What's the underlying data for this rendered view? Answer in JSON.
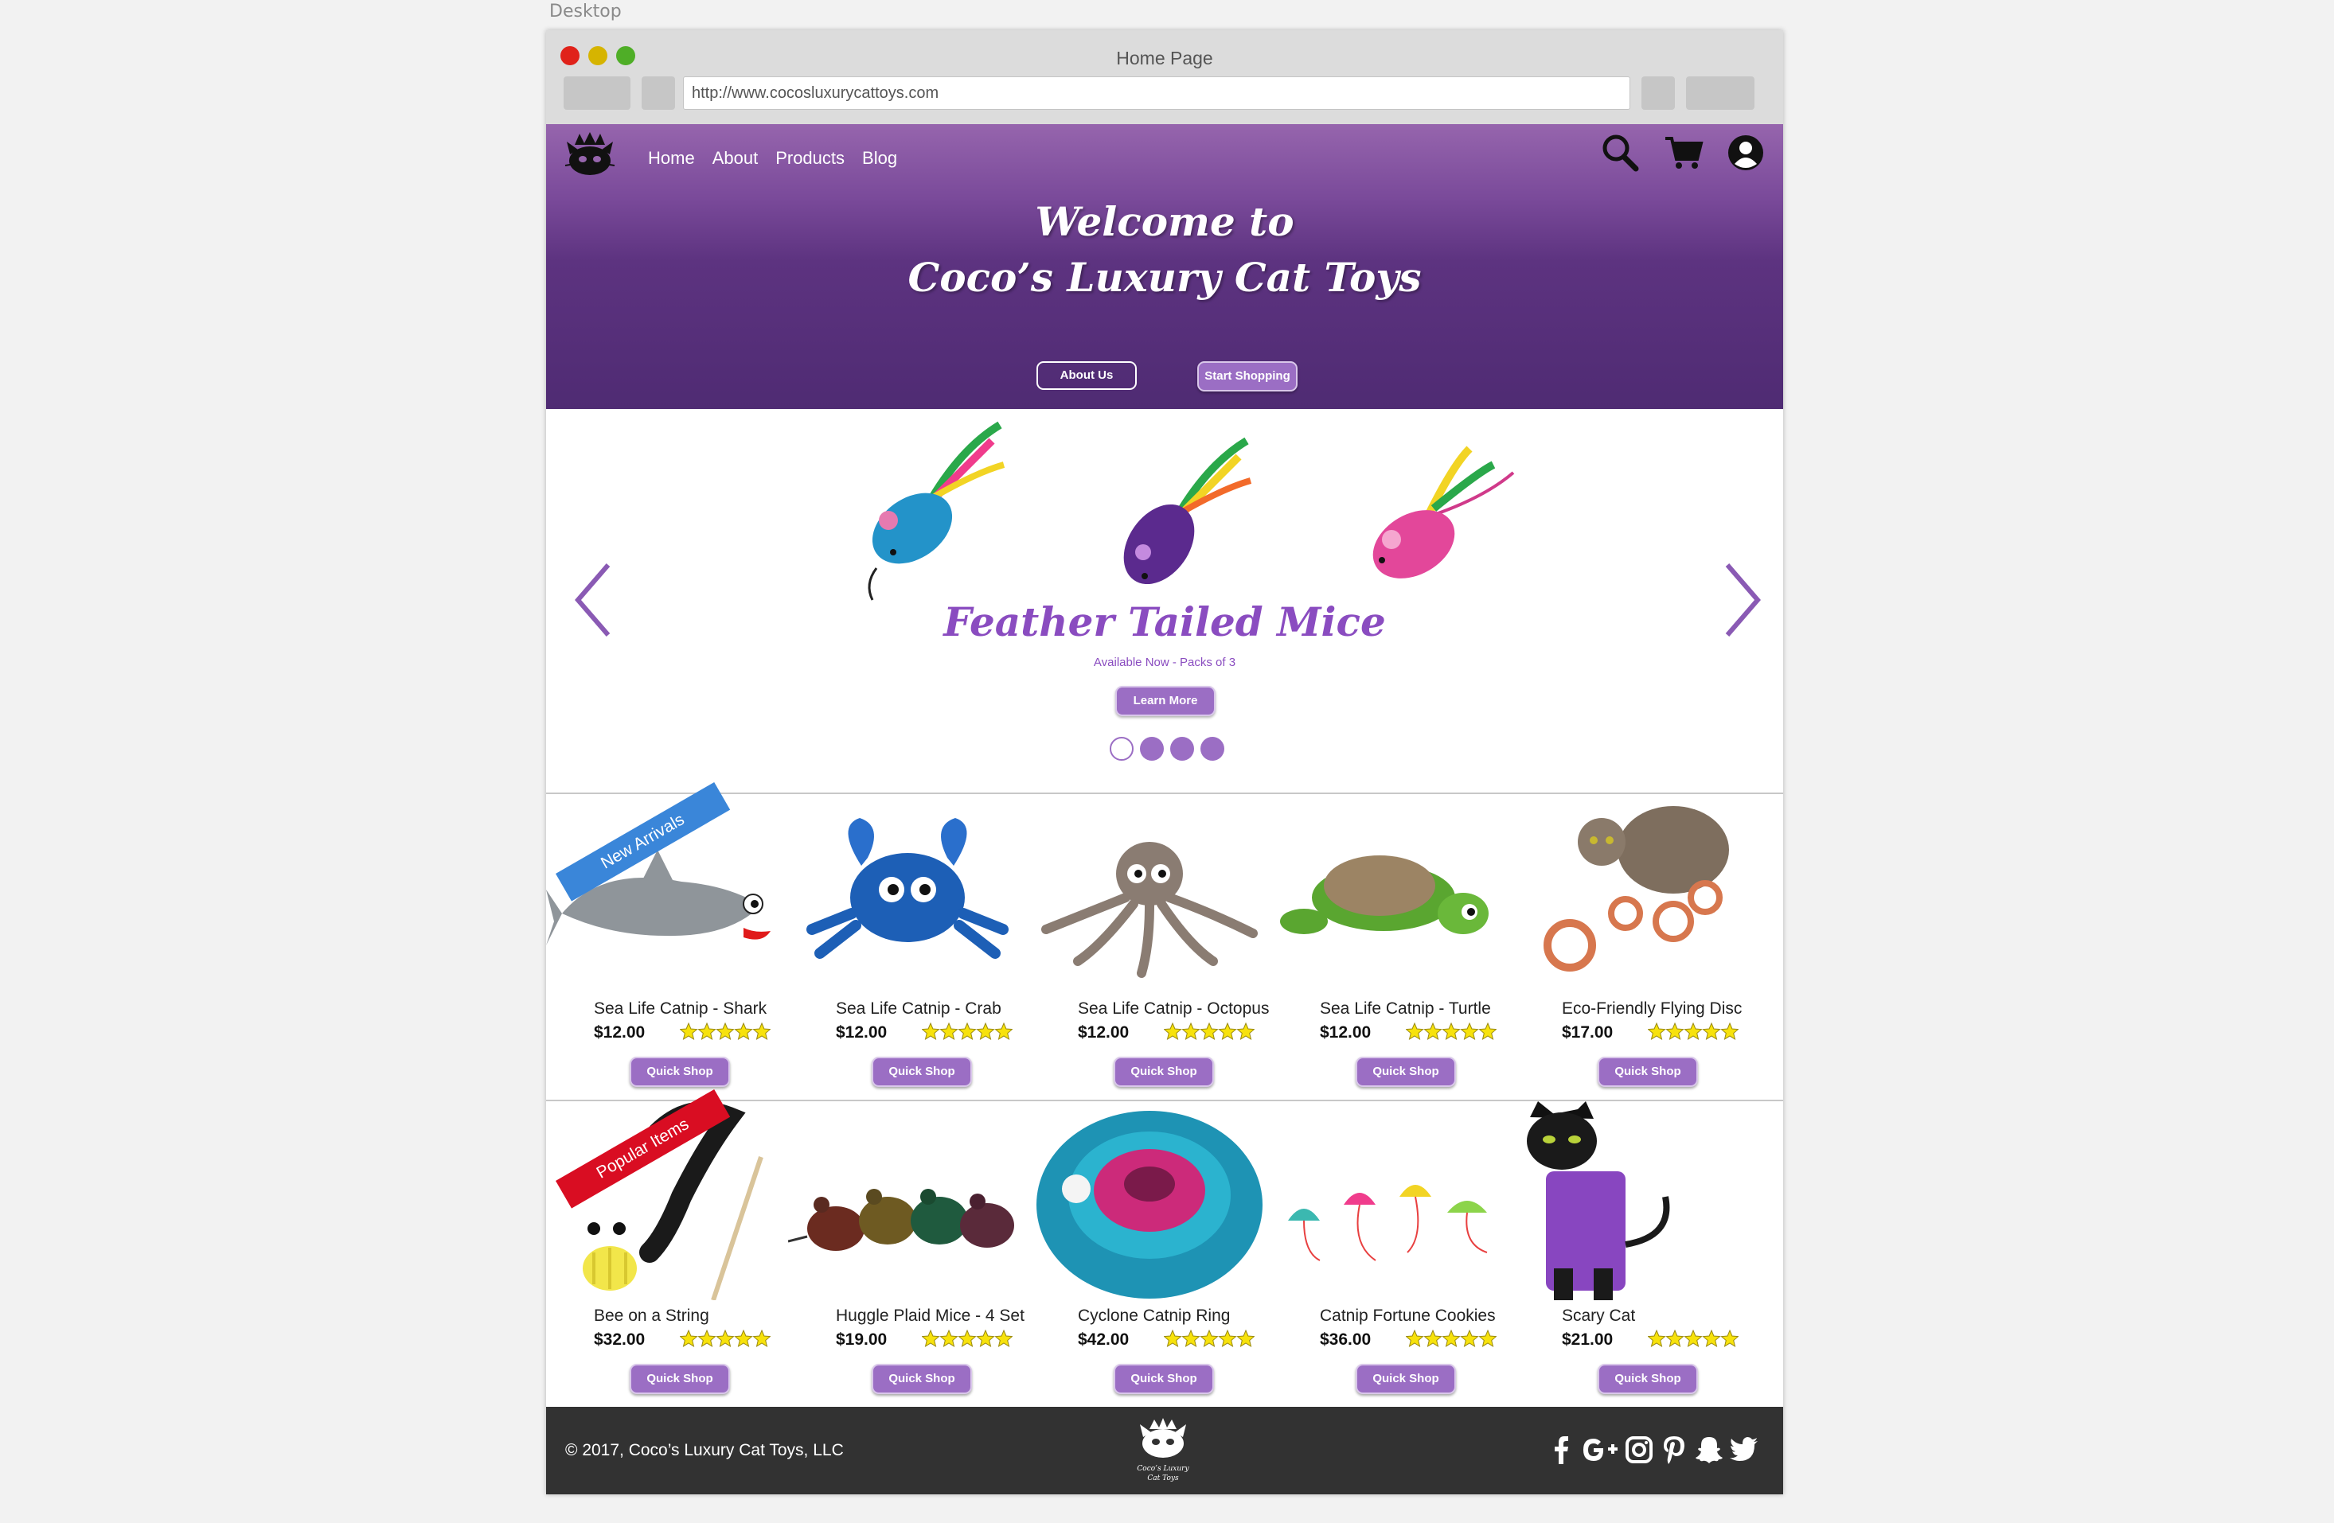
{
  "canvas_label": "Desktop",
  "window": {
    "title": "Home Page",
    "url": "http://www.cocosluxurycattoys.com"
  },
  "header": {
    "nav": [
      "Home",
      "About",
      "Products",
      "Blog"
    ],
    "icons": [
      "search-icon",
      "cart-icon",
      "account-icon"
    ]
  },
  "hero": {
    "title_line1": "Welcome to",
    "title_line2": "Coco’s Luxury Cat Toys",
    "about_button": "About Us",
    "shop_button": "Start Shopping"
  },
  "carousel": {
    "title": "Feather Tailed Mice",
    "subtitle": "Available Now - Packs of 3",
    "button": "Learn More",
    "slide_count": 4,
    "active_slide": 1
  },
  "rows": [
    {
      "ribbon": "New Arrivals",
      "products": [
        {
          "name": "Sea Life Catnip - Shark",
          "price": "$12.00",
          "rating": 5
        },
        {
          "name": "Sea Life Catnip - Crab",
          "price": "$12.00",
          "rating": 5
        },
        {
          "name": "Sea Life Catnip - Octopus",
          "price": "$12.00",
          "rating": 5
        },
        {
          "name": "Sea Life Catnip - Turtle",
          "price": "$12.00",
          "rating": 5
        },
        {
          "name": "Eco-Friendly Flying Disc",
          "price": "$17.00",
          "rating": 5
        }
      ]
    },
    {
      "ribbon": "Popular Items",
      "products": [
        {
          "name": "Bee on a String",
          "price": "$32.00",
          "rating": 5
        },
        {
          "name": "Huggle Plaid Mice - 4 Set",
          "price": "$19.00",
          "rating": 5
        },
        {
          "name": "Cyclone Catnip Ring",
          "price": "$42.00",
          "rating": 5
        },
        {
          "name": "Catnip Fortune Cookies",
          "price": "$36.00",
          "rating": 5
        },
        {
          "name": "Scary Cat",
          "price": "$21.00",
          "rating": 5
        }
      ]
    }
  ],
  "quick_shop_label": "Quick Shop",
  "footer": {
    "copyright": "2017, Coco’s Luxury Cat Toys, LLC",
    "logo_text_1": "Coco’s Luxury",
    "logo_text_2": "Cat Toys",
    "social": [
      "facebook-icon",
      "google-plus-icon",
      "instagram-icon",
      "pinterest-icon",
      "snapchat-icon",
      "twitter-icon"
    ]
  },
  "colors": {
    "brand_purple": "#9b6ec4",
    "hero_dark": "#4f2b73",
    "promo_text": "#8a4cc0",
    "footer_bg": "#323232",
    "ribbon_blue": "#3a86d9",
    "ribbon_red": "#d90d22",
    "star": "#f7e20c"
  }
}
